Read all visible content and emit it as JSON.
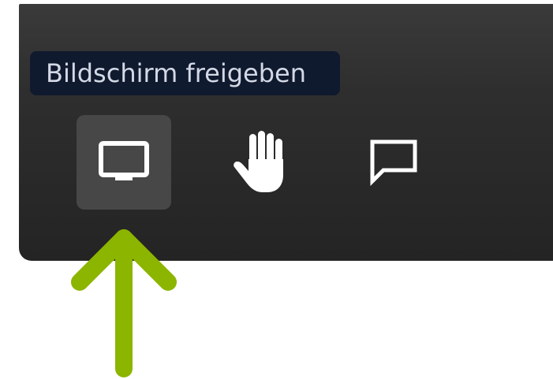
{
  "tooltip": {
    "text": "Bildschirm freigeben"
  },
  "toolbar": {
    "buttons": [
      {
        "icon": "screen-share-icon",
        "active": true
      },
      {
        "icon": "raise-hand-icon",
        "active": false
      },
      {
        "icon": "chat-bubble-icon",
        "active": false
      }
    ]
  },
  "annotation": {
    "icon": "arrow-up-icon",
    "color": "#8cb500"
  },
  "colors": {
    "toolbar_bg": "#2e2e2e",
    "active_button_bg": "#474747",
    "tooltip_bg": "#101a2e",
    "tooltip_text": "#d3d9e6",
    "icon": "#ffffff"
  }
}
